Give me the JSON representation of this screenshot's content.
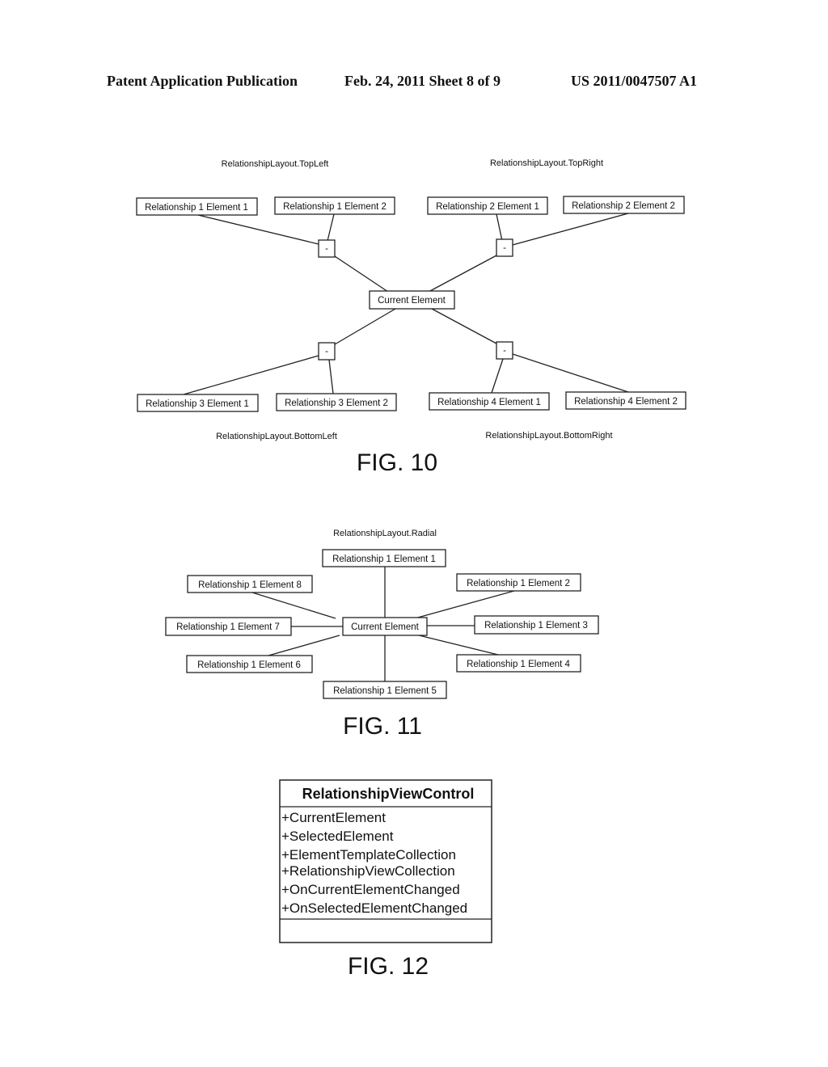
{
  "header": {
    "left": "Patent Application Publication",
    "middle": "Feb. 24, 2011   Sheet 8 of 9",
    "right": "US 2011/0047507 A1"
  },
  "fig10": {
    "caption": "FIG. 10",
    "current": "Current Element",
    "junction_label": "-",
    "quadrants": [
      {
        "label": "RelationshipLayout.TopLeft",
        "elements": [
          "Relationship 1 Element 1",
          "Relationship 1 Element 2"
        ]
      },
      {
        "label": "RelationshipLayout.TopRight",
        "elements": [
          "Relationship 2 Element 1",
          "Relationship 2 Element 2"
        ]
      },
      {
        "label": "RelationshipLayout.BottomLeft",
        "elements": [
          "Relationship 3 Element 1",
          "Relationship 3 Element 2"
        ]
      },
      {
        "label": "RelationshipLayout.BottomRight",
        "elements": [
          "Relationship 4 Element 1",
          "Relationship 4 Element 2"
        ]
      }
    ]
  },
  "fig11": {
    "caption": "FIG. 11",
    "label": "RelationshipLayout.Radial",
    "current": "Current Element",
    "elements": [
      "Relationship 1 Element 1",
      "Relationship 1 Element 2",
      "Relationship 1 Element 3",
      "Relationship 1 Element 4",
      "Relationship 1 Element 5",
      "Relationship 1 Element 6",
      "Relationship 1 Element 7",
      "Relationship 1 Element 8"
    ]
  },
  "fig12": {
    "caption": "FIG. 12",
    "class_name": "RelationshipViewControl",
    "members": [
      "+CurrentElement",
      "+SelectedElement",
      "+ElementTemplateCollection",
      "+RelationshipViewCollection",
      "+OnCurrentElementChanged",
      "+OnSelectedElementChanged"
    ]
  }
}
